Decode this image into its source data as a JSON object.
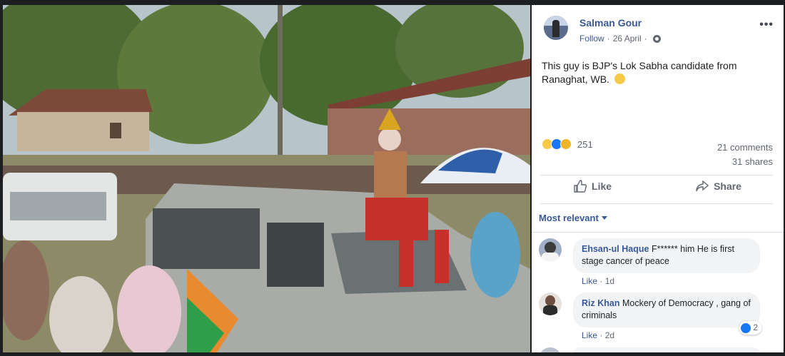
{
  "post": {
    "author": "Salman Gour",
    "follow_label": "Follow",
    "date": "26 April",
    "separator": "·",
    "more_label": "•••",
    "text": "This guy is BJP's Lok Sabha candidate from Ranaghat, WB.",
    "emoji_icon": "smiling-face-emoji",
    "reaction_count": "251",
    "reaction_icons": [
      "haha-reaction-icon",
      "like-reaction-icon",
      "wow-reaction-icon"
    ],
    "comments_count": "21 comments",
    "shares_count": "31 shares"
  },
  "actions": {
    "like_label": "Like",
    "share_label": "Share"
  },
  "comments_section": {
    "sort_label": "Most relevant",
    "comments": [
      {
        "name": "Ehsan-ul Haque",
        "text": "F****** him He is first stage cancer of peace",
        "like_label": "Like",
        "age": "1d"
      },
      {
        "name": "Riz Khan",
        "text": "Mockery of Democracy , gang of criminals",
        "like_label": "Like",
        "age": "2d",
        "reaction_count": "2"
      }
    ]
  },
  "colors": {
    "link_blue": "#385898",
    "fb_blue": "#1877f2",
    "text_gray": "#606770",
    "bubble_gray": "#f2f3f5",
    "backdrop": "#1c1e21"
  }
}
